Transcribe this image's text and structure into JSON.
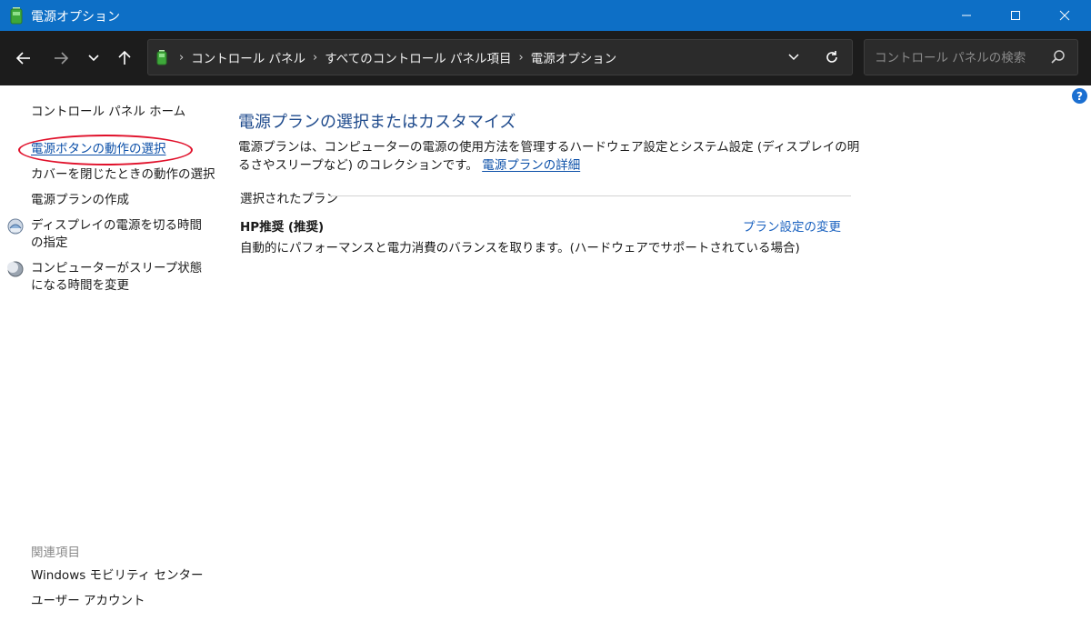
{
  "window": {
    "title": "電源オプション",
    "accent": "#0d6fc6"
  },
  "navbar": {
    "breadcrumb": [
      "コントロール パネル",
      "すべてのコントロール パネル項目",
      "電源オプション"
    ],
    "search_placeholder": "コントロール パネルの検索"
  },
  "sidebar": {
    "home": "コントロール パネル ホーム",
    "items": [
      {
        "label": "電源ボタンの動作の選択",
        "icon": null
      },
      {
        "label": "カバーを閉じたときの動作の選択",
        "icon": null
      },
      {
        "label": "電源プランの作成",
        "icon": null
      },
      {
        "label": "ディスプレイの電源を切る時間の指定",
        "icon": "display-icon"
      },
      {
        "label": "コンピューターがスリープ状態になる時間を変更",
        "icon": "moon-icon"
      }
    ],
    "related_heading": "関連項目",
    "related": [
      "Windows モビリティ センター",
      "ユーザー アカウント"
    ]
  },
  "main": {
    "heading": "電源プランの選択またはカスタマイズ",
    "description": "電源プランは、コンピューターの電源の使用方法を管理するハードウェア設定とシステム設定 (ディスプレイの明るさやスリープなど) のコレクションです。",
    "details_link": "電源プランの詳細",
    "selected_plan_heading": "選択されたプラン",
    "plan": {
      "name": "HP推奨 (推奨)",
      "description": "自動的にパフォーマンスと電力消費のバランスを取ります。(ハードウェアでサポートされている場合)",
      "change_link": "プラン設定の変更"
    }
  },
  "help_label": "?"
}
